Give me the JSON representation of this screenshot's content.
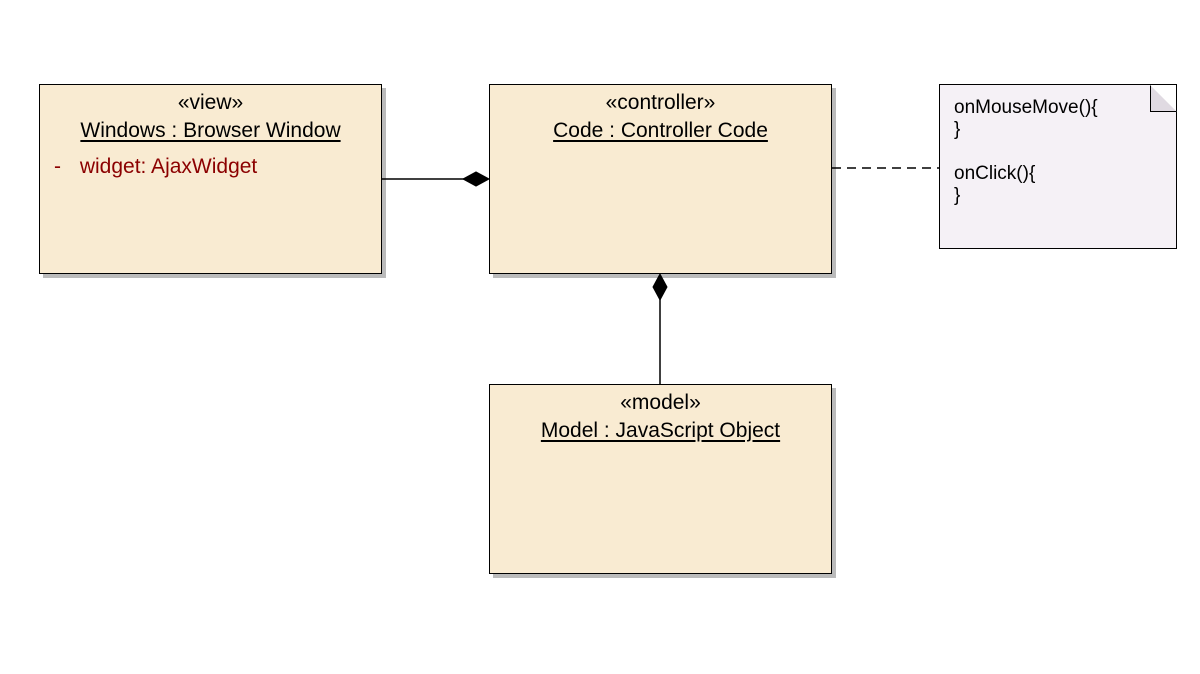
{
  "view": {
    "stereotype": "«view»",
    "name": "Windows : Browser Window",
    "attr_vis": "-",
    "attr_text": "widget: AjaxWidget"
  },
  "controller": {
    "stereotype": "«controller»",
    "name": "Code : Controller Code"
  },
  "model": {
    "stereotype": "«model»",
    "name": "Model : JavaScript Object"
  },
  "note": {
    "text": "onMouseMove(){\n}\n\nonClick(){\n}"
  }
}
